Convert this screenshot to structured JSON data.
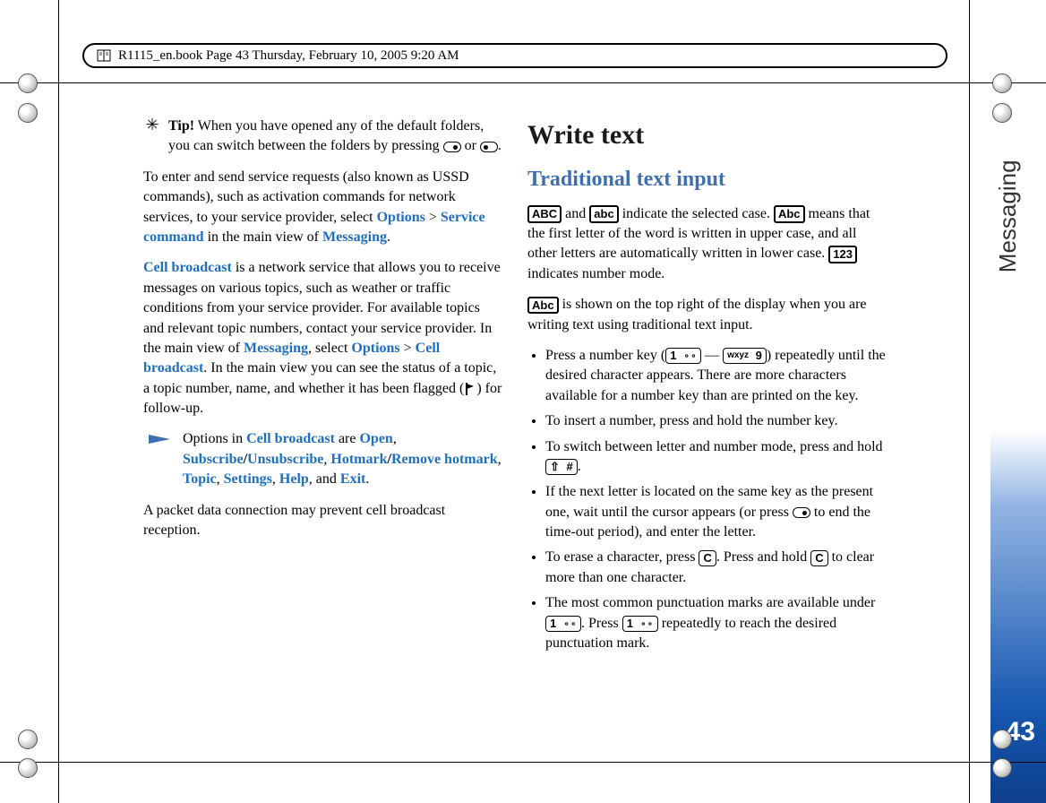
{
  "header": {
    "runhead": "R1115_en.book  Page 43  Thursday, February 10, 2005  9:20 AM"
  },
  "left": {
    "tip_label": "Tip!",
    "tip_text_a": " When you have opened any of the default folders, you can switch between the folders by pressing ",
    "tip_text_b": " or ",
    "p1_a": "To enter and send service requests (also known as USSD commands), such as activation commands for network services, to your service provider, select ",
    "options": "Options",
    "gt": " > ",
    "service_command": "Service command",
    "p1_b": " in the main view of ",
    "messaging": "Messaging",
    "p2_a": "Cell broadcast",
    "p2_b": " is a network service that allows you to receive messages on various topics, such as weather or traffic conditions from your service provider. For available topics and relevant topic numbers, contact your service provider. In the main view of ",
    "p2_c": ", select ",
    "p2_d": ". In the main view you can see the status of a topic, a topic number, name, and whether it has been flagged (",
    "p2_e": ") for follow-up.",
    "note_a": "Options in ",
    "note_b": " are ",
    "open": "Open",
    "subscribe": "Subscribe",
    "unsubscribe": "Unsubscribe",
    "hotmark": "Hotmark",
    "remove_hotmark": "Remove hotmark",
    "topic": "Topic",
    "settings": "Settings",
    "help": "Help",
    "and": ", and ",
    "exit": "Exit",
    "p3": "A packet data connection may prevent cell broadcast reception."
  },
  "right": {
    "h1": "Write text",
    "h2": "Traditional text input",
    "abc_u": "ABC",
    "abc_l": "abc",
    "abc_title": "Abc",
    "num_mode": "123",
    "p1_a": " and ",
    "p1_b": " indicate the selected case. ",
    "p1_c": " means that the first letter of the word is written in upper case, and all other letters are automatically written in lower case. ",
    "p1_d": " indicates number mode.",
    "p2": " is shown on the top right of the display when you are writing text using traditional text input.",
    "b1_a": "Press a number key (",
    "key1_num": "1",
    "key1_icon": "☉",
    "dash": " — ",
    "key9_text": "wxyz",
    "key9_num": "9",
    "b1_b": ") repeatedly until the desired character appears. There are more characters available for a number key than are printed on the key.",
    "b2": "To insert a number, press and hold the number key.",
    "b3_a": "To switch between letter and number mode, press and hold ",
    "hash_shift": "⇧",
    "hash": "#",
    "b4_a": "If the next letter is located on the same key as the present one, wait until the cursor appears (or press ",
    "b4_b": " to end the time-out period), and enter the letter.",
    "b5_a": "To erase a character, press ",
    "clear": "C",
    "b5_b": ". Press and hold ",
    "b5_c": " to clear more than one character.",
    "b6_a": "The most common punctuation marks are available under ",
    "b6_b": ". Press ",
    "b6_c": " repeatedly to reach the desired punctuation mark."
  },
  "sidebar": {
    "section": "Messaging",
    "page": "43"
  }
}
